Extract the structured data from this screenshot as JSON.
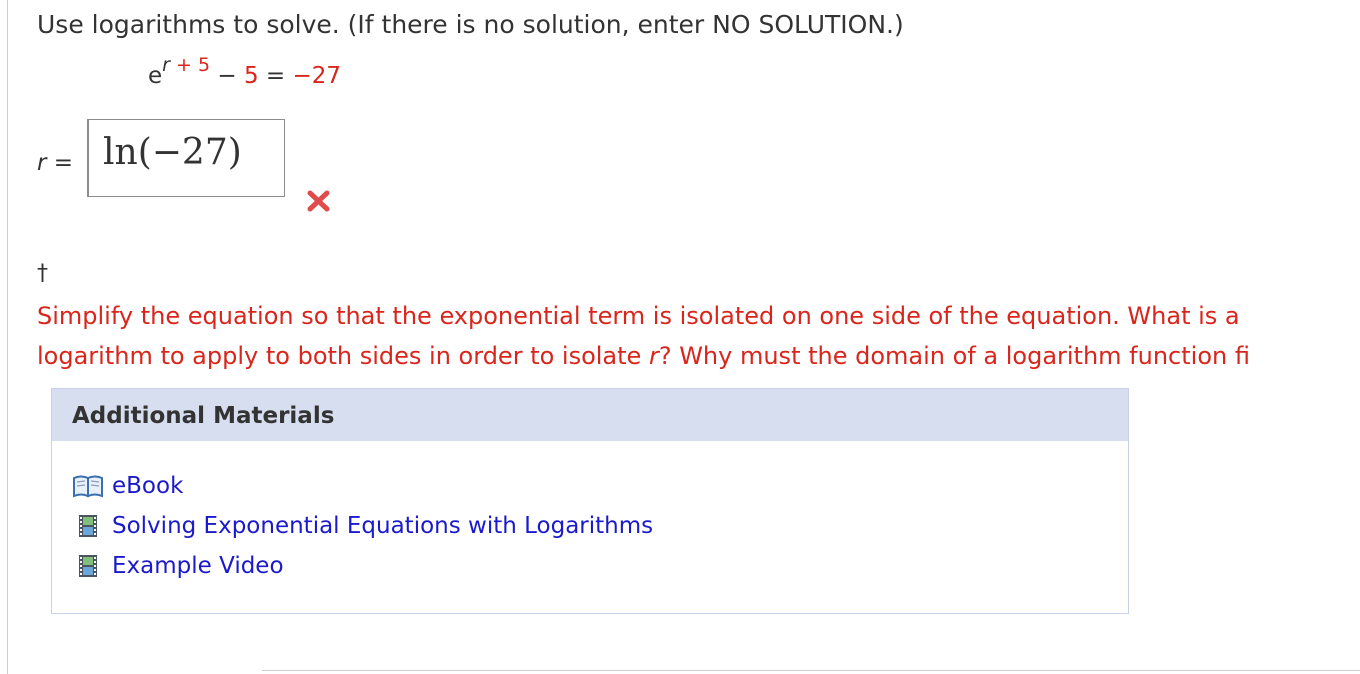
{
  "question": {
    "instruction": "Use logarithms to solve. (If there is no solution, enter NO SOLUTION.)",
    "equation": {
      "base": "e",
      "exponent_var": "r",
      "exponent_rest": " + 5",
      "minus": "−",
      "const": "5",
      "equals": "=",
      "rhs": "−27"
    },
    "answer_var": "r",
    "answer_eq": " =",
    "answer_value": "ln(−27)",
    "result_status": "incorrect",
    "result_color": "#e04b4b"
  },
  "feedback": {
    "marker": "†",
    "line1": "Simplify the equation so that the exponential term is isolated on one side of the equation. What is a",
    "line2_prefix": "logarithm to apply to both sides in order to isolate ",
    "line2_var": "r",
    "line2_suffix": "? Why must the domain of a logarithm function fi",
    "color": "#d9261c"
  },
  "additional_materials": {
    "header": "Additional Materials",
    "items": [
      {
        "label": "eBook",
        "icon": "book-icon"
      },
      {
        "label": "Solving Exponential Equations with Logarithms",
        "icon": "film-icon"
      },
      {
        "label": "Example Video",
        "icon": "film-icon"
      }
    ]
  },
  "colors": {
    "link": "#1a1acc",
    "header_bg": "#d6deef",
    "panel_border": "#c9d2ea"
  }
}
